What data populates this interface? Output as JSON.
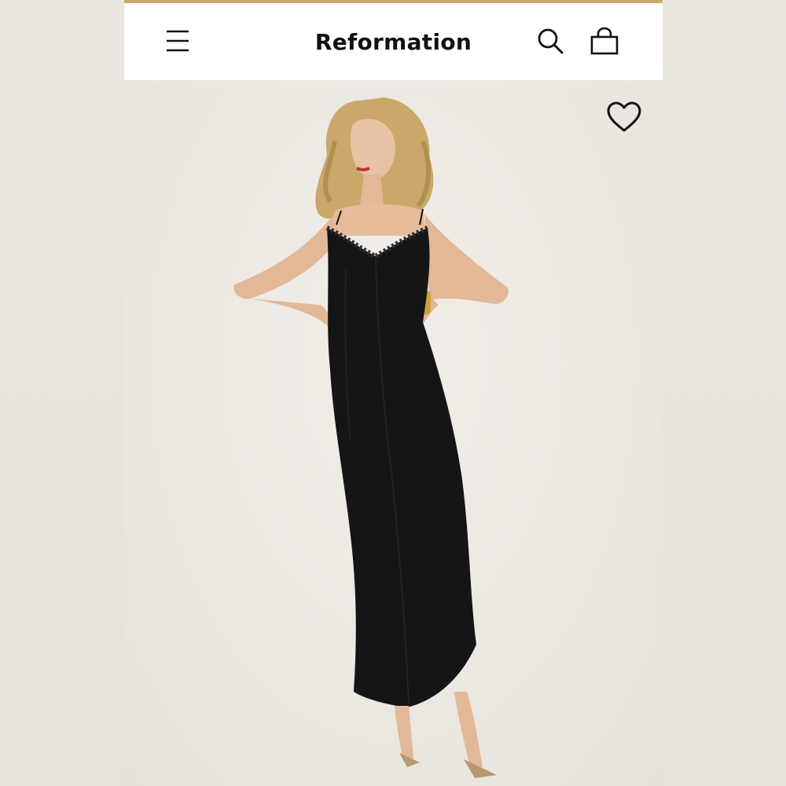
{
  "header": {
    "brand": "Reformation",
    "menu_icon": "hamburger-menu-icon",
    "search_icon": "search-icon",
    "bag_icon": "shopping-bag-icon"
  },
  "product": {
    "image": "model-black-lace-trim-slip-maxi-dress",
    "wishlist_icon": "heart-outline-icon"
  },
  "colors": {
    "accent_bar": "#c8ab6c",
    "header_bg": "#ffffff",
    "page_bg": "#ebe8e3",
    "dress": "#151515",
    "text": "#111111"
  }
}
